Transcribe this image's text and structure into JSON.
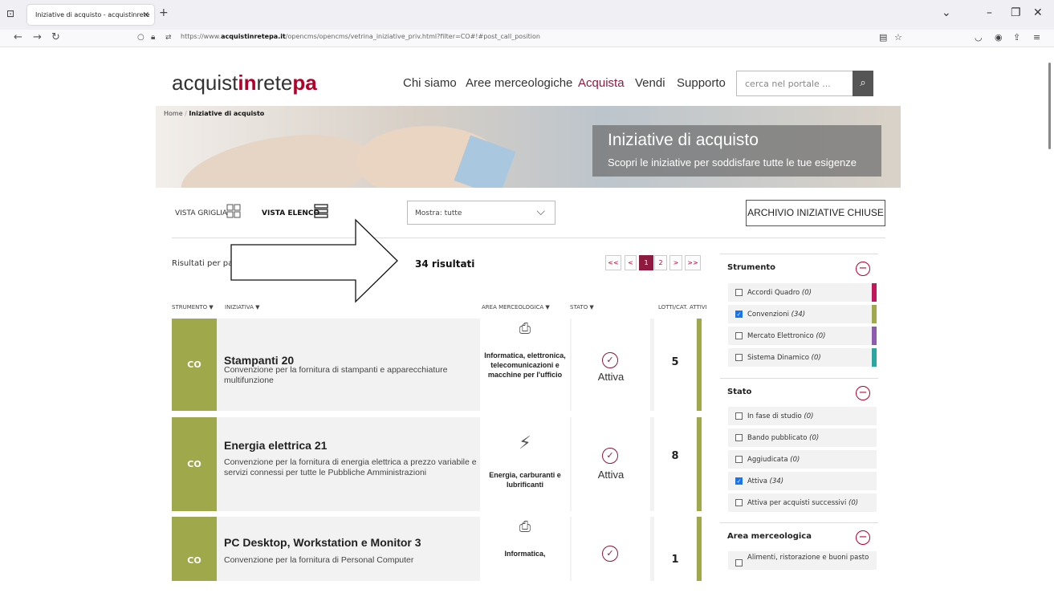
{
  "browser": {
    "tab_title": "Iniziative di acquisto - acquistinrete",
    "tab_close": "×",
    "new_tab": "+",
    "url_prefix": "https://www.",
    "url_domain": "acquistinretepa.it",
    "url_path": "/opencms/opencms/vetrina_iniziative_priv.html?filter=CO#!#post_call_position"
  },
  "header": {
    "logo_part1": "acquist",
    "logo_part2": "in",
    "logo_part3": "rete",
    "logo_part4": "pa",
    "menu": [
      "Chi siamo",
      "Aree merceologiche",
      "Acquista",
      "Vendi",
      "Supporto"
    ],
    "search_placeholder": "cerca nel portale ..."
  },
  "breadcrumb": {
    "home": "Home",
    "separator": "/",
    "current": "Iniziative di acquisto"
  },
  "hero": {
    "title": "Iniziative di acquisto",
    "subtitle": "Scopri le iniziative per soddisfare tutte le tue esigenze"
  },
  "controls": {
    "vista_griglia": "VISTA GRIGLIA",
    "vista_elenco": "VISTA ELENCO",
    "mostra": "Mostra: tutte",
    "archivio": "ARCHIVIO INIZIATIVE CHIUSE",
    "risultati_per_pagina": "Risultati per pagi",
    "risultati_count": "34 risultati"
  },
  "pagination": [
    "<<",
    "<",
    "1",
    "2",
    ">",
    ">>"
  ],
  "columns": {
    "strumento": "STRUMENTO ▼",
    "iniziativa": "INIZIATIVA ▼",
    "area": "AREA MERCEOLOGICA ▼",
    "stato": "STATO ▼",
    "lotti": "LOTTI/CAT. ATTIVI"
  },
  "rows": [
    {
      "code": "CO",
      "title": "Stampanti 20",
      "description": "Convenzione per la fornitura di stampanti e apparecchiature multifunzione",
      "area": "Informatica, elettronica, telecomunicazioni e macchine per l'ufficio",
      "area_icon": "printer-icon",
      "stato": "Attiva",
      "lotti": "5"
    },
    {
      "code": "CO",
      "title": "Energia elettrica 21",
      "description": "Convenzione per la fornitura di energia elettrica a prezzo variabile e servizi connessi per tutte le Pubbliche Amministrazioni",
      "area": "Energia, carburanti e lubrificanti",
      "area_icon": "power-tower-icon",
      "stato": "Attiva",
      "lotti": "8"
    },
    {
      "code": "CO",
      "title": "PC Desktop, Workstation e Monitor 3",
      "description": "Convenzione per la fornitura di Personal Computer",
      "area": "Informatica,",
      "area_icon": "printer-icon",
      "stato": "",
      "lotti": "1"
    }
  ],
  "sidebar": {
    "strumento": {
      "label": "Strumento",
      "items": [
        {
          "label": "Accordi Quadro",
          "count": "(0)",
          "checked": false,
          "color": "#c2185b"
        },
        {
          "label": "Convenzioni",
          "count": "(34)",
          "checked": true,
          "color": "#9fa84a"
        },
        {
          "label": "Mercato Elettronico",
          "count": "(0)",
          "checked": false,
          "color": "#8e5bb0"
        },
        {
          "label": "Sistema Dinamico",
          "count": "(0)",
          "checked": false,
          "color": "#2aa7a0"
        }
      ]
    },
    "stato": {
      "label": "Stato",
      "items": [
        {
          "label": "In fase di studio",
          "count": "(0)",
          "checked": false
        },
        {
          "label": "Bando pubblicato",
          "count": "(0)",
          "checked": false
        },
        {
          "label": "Aggiudicata",
          "count": "(0)",
          "checked": false
        },
        {
          "label": "Attiva",
          "count": "(34)",
          "checked": true
        },
        {
          "label": "Attiva per acquisti successivi",
          "count": "(0)",
          "checked": false
        }
      ]
    },
    "area": {
      "label": "Area merceologica",
      "items": [
        {
          "label": "Alimenti, ristorazione e buoni pasto",
          "count": "",
          "checked": false
        }
      ]
    }
  },
  "colors": {
    "brand": "#b2002b",
    "accent": "#8f1a3f",
    "co_green": "#9fa84a"
  }
}
